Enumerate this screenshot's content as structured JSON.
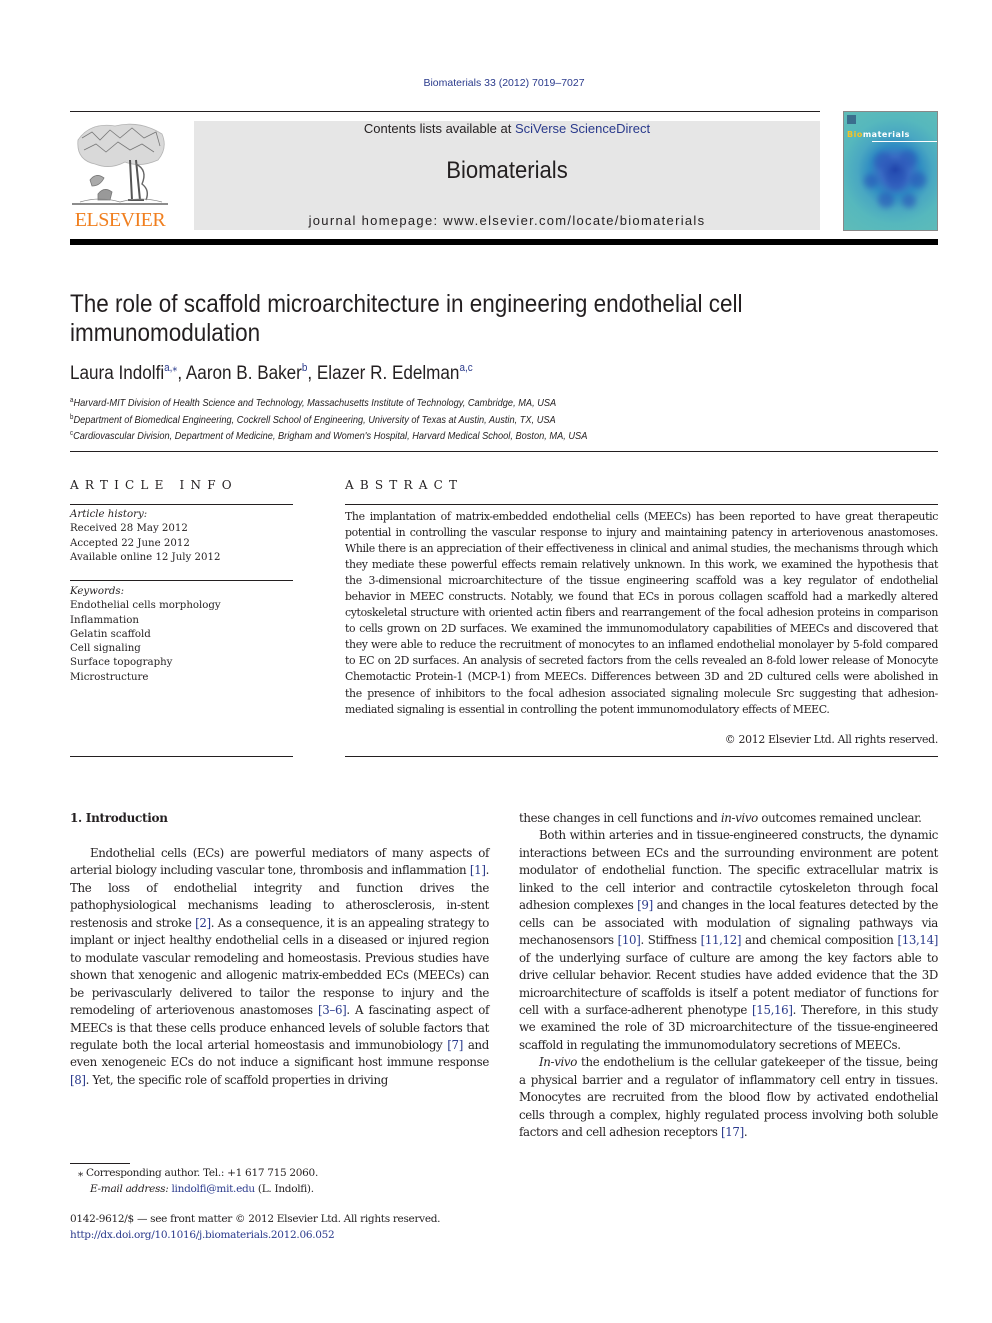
{
  "header": {
    "journal_ref": "Biomaterials 33 (2012) 7019–7027",
    "contents_prefix": "Contents lists available at ",
    "contents_link": "SciVerse ScienceDirect",
    "journal_name": "Biomaterials",
    "homepage_prefix": "journal homepage: ",
    "homepage_url": "www.elsevier.com/locate/biomaterials",
    "publisher_wordmark": "ELSEVIER",
    "cover_title_accent": "Bio",
    "cover_title_rest": "materials",
    "publisher_color": "#f07f1f",
    "link_color": "#2a3a8c"
  },
  "article": {
    "title": "The role of scaffold microarchitecture in engineering endothelial cell immunomodulation",
    "authors": [
      {
        "name": "Laura Indolfi",
        "sup": "a,⁎"
      },
      {
        "name": "Aaron B. Baker",
        "sup": "b"
      },
      {
        "name": "Elazer R. Edelman",
        "sup": "a,c"
      }
    ],
    "affiliations": [
      {
        "key": "a",
        "text": "Harvard-MIT Division of Health Science and Technology, Massachusetts Institute of Technology, Cambridge, MA, USA"
      },
      {
        "key": "b",
        "text": "Department of Biomedical Engineering, Cockrell School of Engineering, University of Texas at Austin, Austin, TX, USA"
      },
      {
        "key": "c",
        "text": "Cardiovascular Division, Department of Medicine, Brigham and Women's Hospital, Harvard Medical School, Boston, MA, USA"
      }
    ]
  },
  "article_info": {
    "heading": "ARTICLE INFO",
    "history_label": "Article history:",
    "history": [
      "Received 28 May 2012",
      "Accepted 22 June 2012",
      "Available online 12 July 2012"
    ],
    "keywords_label": "Keywords:",
    "keywords": [
      "Endothelial cells morphology",
      "Inflammation",
      "Gelatin scaffold",
      "Cell signaling",
      "Surface topography",
      "Microstructure"
    ]
  },
  "abstract": {
    "heading": "ABSTRACT",
    "text": "The implantation of matrix-embedded endothelial cells (MEECs) has been reported to have great therapeutic potential in controlling the vascular response to injury and maintaining patency in arteriovenous anastomoses. While there is an appreciation of their effectiveness in clinical and animal studies, the mechanisms through which they mediate these powerful effects remain relatively unknown. In this work, we examined the hypothesis that the 3-dimensional microarchitecture of the tissue engineering scaffold was a key regulator of endothelial behavior in MEEC constructs. Notably, we found that ECs in porous collagen scaffold had a markedly altered cytoskeletal structure with oriented actin fibers and rearrangement of the focal adhesion proteins in comparison to cells grown on 2D surfaces. We examined the immunomodulatory capabilities of MEECs and discovered that they were able to reduce the recruitment of monocytes to an inflamed endothelial monolayer by 5-fold compared to EC on 2D surfaces. An analysis of secreted factors from the cells revealed an 8-fold lower release of Monocyte Chemotactic Protein-1 (MCP-1) from MEECs. Differences between 3D and 2D cultured cells were abolished in the presence of inhibitors to the focal adhesion associated signaling molecule Src suggesting that adhesion-mediated signaling is essential in controlling the potent immunomodulatory effects of MEEC.",
    "copyright": "© 2012 Elsevier Ltd. All rights reserved."
  },
  "introduction": {
    "heading": "1.  Introduction",
    "left_paragraph": [
      {
        "t": "Endothelial cells (ECs) are powerful mediators of many aspects of arterial biology including vascular tone, thrombosis and inflammation "
      },
      {
        "ref": "[1]"
      },
      {
        "t": ". The loss of endothelial integrity and function drives the pathophysiological mechanisms leading to atherosclerosis, in-stent restenosis and stroke "
      },
      {
        "ref": "[2]"
      },
      {
        "t": ". As a consequence, it is an appealing strategy to implant or inject healthy endothelial cells in a diseased or injured region to modulate vascular remodeling and homeostasis. Previous studies have shown that xenogenic and allogenic matrix-embedded ECs (MEECs) can be perivascularly delivered to tailor the response to injury and the remodeling of arteriovenous anastomoses "
      },
      {
        "ref": "[3–6]"
      },
      {
        "t": ". A fascinating aspect of MEECs is that these cells produce enhanced levels of soluble factors that regulate both the local arterial homeostasis and immunobiology "
      },
      {
        "ref": "[7]"
      },
      {
        "t": " and even xenogeneic ECs do not induce a significant host immune response "
      },
      {
        "ref": "[8]"
      },
      {
        "t": ". Yet, the specific role of scaffold properties in driving"
      }
    ],
    "right_continuation": [
      {
        "t": "these changes in cell functions and "
      },
      {
        "i": "in-vivo"
      },
      {
        "t": " outcomes remained unclear."
      }
    ],
    "right_paragraph_2": [
      {
        "t": "Both within arteries and in tissue-engineered constructs, the dynamic interactions between ECs and the surrounding environment are potent modulator of endothelial function. The specific extracellular matrix is linked to the cell interior and contractile cytoskeleton through focal adhesion complexes "
      },
      {
        "ref": "[9]"
      },
      {
        "t": " and changes in the local features detected by the cells can be associated with modulation of signaling pathways via mechanosensors "
      },
      {
        "ref": "[10]"
      },
      {
        "t": ". Stiffness "
      },
      {
        "ref": "[11,12]"
      },
      {
        "t": " and chemical composition "
      },
      {
        "ref": "[13,14]"
      },
      {
        "t": " of the underlying surface of culture are among the key factors able to drive cellular behavior. Recent studies have added evidence that the 3D microarchitecture of scaffolds is itself a potent mediator of functions for cell with a surface-adherent phenotype "
      },
      {
        "ref": "[15,16]"
      },
      {
        "t": ". Therefore, in this study we examined the role of 3D microarchitecture of the tissue-engineered scaffold in regulating the immunomodulatory secretions of MEECs."
      }
    ],
    "right_paragraph_3": [
      {
        "i": "In-vivo"
      },
      {
        "t": " the endothelium is the cellular gatekeeper of the tissue, being a physical barrier and a regulator of inflammatory cell entry in tissues. Monocytes are recruited from the blood flow by activated endothelial cells through a complex, highly regulated process involving both soluble factors and cell adhesion receptors "
      },
      {
        "ref": "[17]"
      },
      {
        "t": "."
      }
    ]
  },
  "footnotes": {
    "marker": "⁎",
    "corresponding": "Corresponding author. Tel.: +1 617 715 2060.",
    "email_label": "E-mail address:",
    "email": "lindolfi@mit.edu",
    "email_suffix": " (L. Indolfi).",
    "front_matter": "0142-9612/$ — see front matter © 2012 Elsevier Ltd. All rights reserved.",
    "doi": "http://dx.doi.org/10.1016/j.biomaterials.2012.06.052"
  }
}
